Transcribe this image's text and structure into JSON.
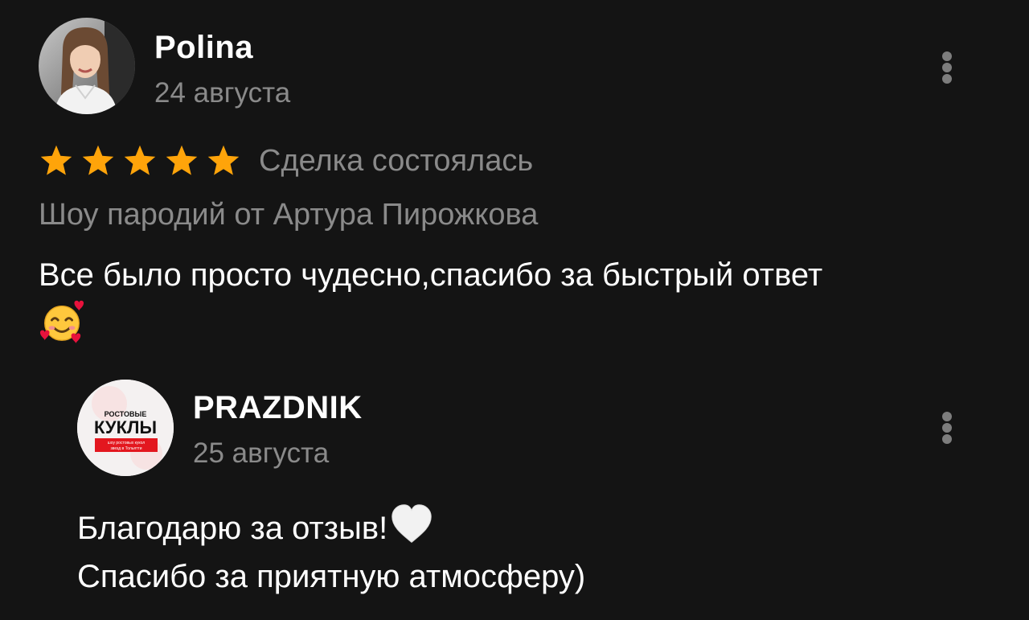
{
  "review": {
    "author": "Polina",
    "date": "24 августа",
    "rating": 5,
    "deal_status": "Сделка состоялась",
    "service": "Шоу пародий от Артура Пирожкова",
    "text": "Все было просто чудесно,спасибо за быстрый ответ",
    "emoji": "smiling-face-with-hearts"
  },
  "reply": {
    "author": "PRAZDNIK",
    "date": "25 августа",
    "avatar_logo": {
      "line1": "РОСТОВЫЕ",
      "line2": "КУКЛЫ",
      "line3": "шоу ростовых кукол",
      "line4": "звезд в Тольятти"
    },
    "text_line1": "Благодарю за отзыв!",
    "text_line1_emoji": "white-heart",
    "text_line2": "Спасибо за приятную атмосферу)"
  },
  "colors": {
    "background": "#141414",
    "primary_text": "#ffffff",
    "secondary_text": "#8a8a8a",
    "star": "#ffa40a",
    "menu_dots": "#7d7d7d",
    "logo_red": "#e3171f"
  },
  "icons": {
    "star": "star-icon",
    "menu": "more-vertical-icon"
  }
}
